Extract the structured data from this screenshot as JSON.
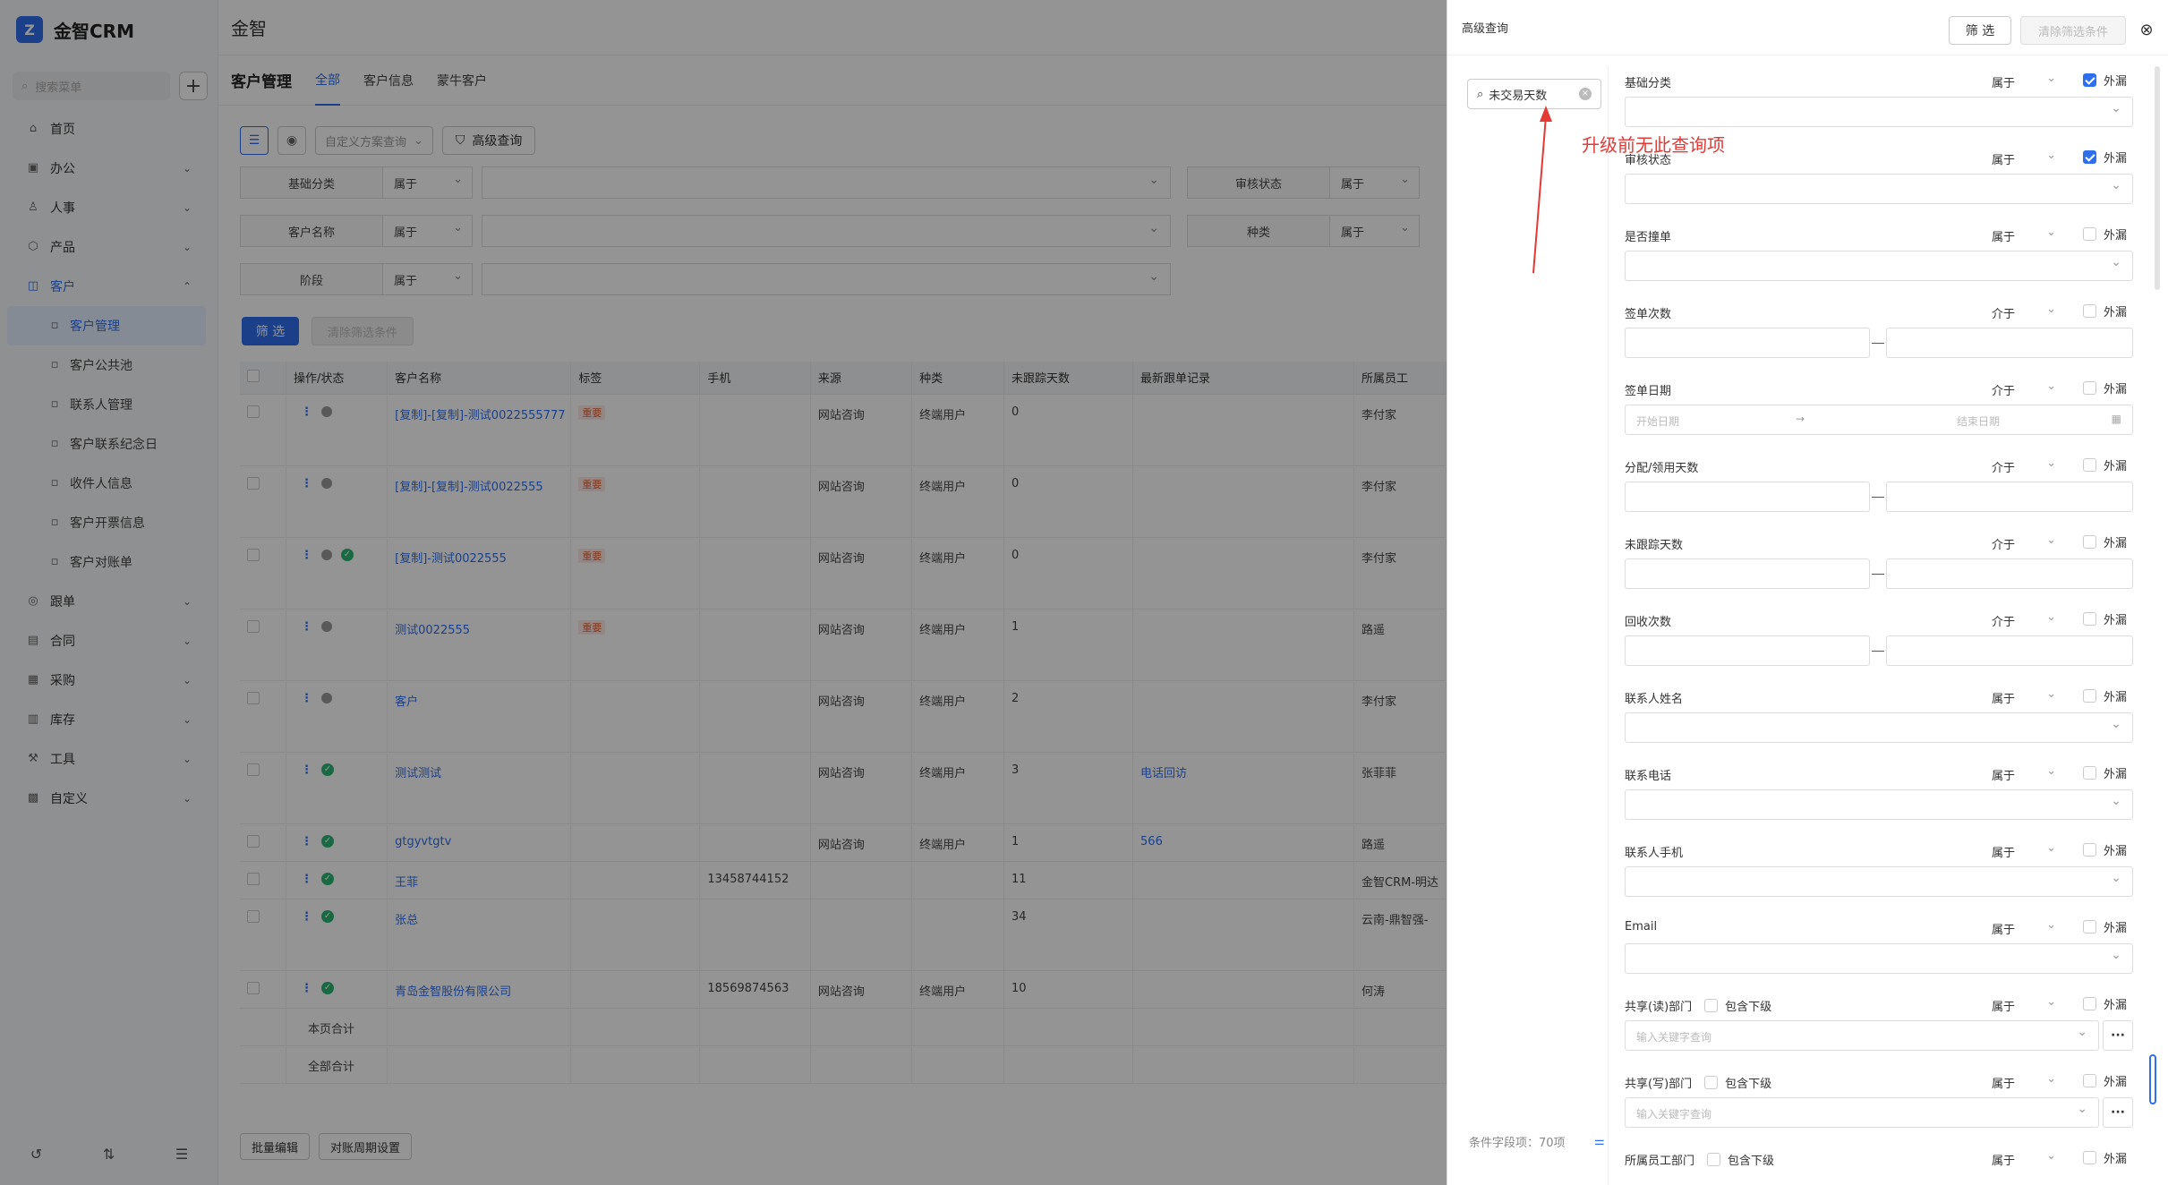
{
  "app": {
    "brand": "金智CRM",
    "page_title": "金智"
  },
  "sidebar": {
    "search_placeholder": "搜索菜单",
    "items": [
      {
        "label": "首页",
        "icon": "home-icon",
        "expandable": false
      },
      {
        "label": "办公",
        "icon": "office-icon",
        "expandable": true
      },
      {
        "label": "人事",
        "icon": "people-icon",
        "expandable": true
      },
      {
        "label": "产品",
        "icon": "product-icon",
        "expandable": true
      },
      {
        "label": "客户",
        "icon": "customer-icon",
        "expandable": true,
        "expanded": true
      },
      {
        "label": "跟单",
        "icon": "follow-icon",
        "expandable": true
      },
      {
        "label": "合同",
        "icon": "contract-icon",
        "expandable": true
      },
      {
        "label": "采购",
        "icon": "purchase-icon",
        "expandable": true
      },
      {
        "label": "库存",
        "icon": "inventory-icon",
        "expandable": true
      },
      {
        "label": "工具",
        "icon": "tool-icon",
        "expandable": true
      },
      {
        "label": "自定义",
        "icon": "custom-icon",
        "expandable": true
      }
    ],
    "customer_sub": [
      {
        "label": "客户管理",
        "active": true
      },
      {
        "label": "客户公共池"
      },
      {
        "label": "联系人管理"
      },
      {
        "label": "客户联系纪念日"
      },
      {
        "label": "收件人信息"
      },
      {
        "label": "客户开票信息"
      },
      {
        "label": "客户对账单"
      }
    ]
  },
  "main": {
    "section_title": "客户管理",
    "tabs": [
      "全部",
      "客户信息",
      "蒙牛客户"
    ],
    "scheme_placeholder": "自定义方案查询",
    "advanced_query_label": "高级查询",
    "filters": [
      {
        "label": "基础分类",
        "op": "属于",
        "label2": "审核状态",
        "op2": "属于"
      },
      {
        "label": "客户名称",
        "op": "属于",
        "label2": "种类",
        "op2": "属于"
      },
      {
        "label": "阶段",
        "op": "属于"
      }
    ],
    "filter_button": "筛 选",
    "clear_button": "清除筛选条件",
    "table": {
      "headers": [
        "操作/状态",
        "客户名称",
        "标签",
        "手机",
        "来源",
        "种类",
        "未跟踪天数",
        "最新跟单记录",
        "所属员工"
      ],
      "rows": [
        {
          "name": "[复制]-[复制]-测试0022555777",
          "tag": "重要",
          "phone": "",
          "source": "网站咨询",
          "kind": "终端用户",
          "days": "0",
          "record": "",
          "owner": "李付家",
          "status": "user"
        },
        {
          "name": "[复制]-[复制]-测试0022555",
          "tag": "重要",
          "phone": "",
          "source": "网站咨询",
          "kind": "终端用户",
          "days": "0",
          "record": "",
          "owner": "李付家",
          "status": "user"
        },
        {
          "name": "[复制]-测试0022555",
          "tag": "重要",
          "phone": "",
          "source": "网站咨询",
          "kind": "终端用户",
          "days": "0",
          "record": "",
          "owner": "李付家",
          "status": "user-ok"
        },
        {
          "name": "测试0022555",
          "tag": "重要",
          "phone": "",
          "source": "网站咨询",
          "kind": "终端用户",
          "days": "1",
          "record": "",
          "owner": "路遥",
          "status": "user"
        },
        {
          "name": "客户",
          "tag": "",
          "phone": "",
          "source": "网站咨询",
          "kind": "终端用户",
          "days": "2",
          "record": "",
          "owner": "李付家",
          "status": "user"
        },
        {
          "name": "测试测试",
          "tag": "",
          "phone": "",
          "source": "网站咨询",
          "kind": "终端用户",
          "days": "3",
          "record": "电话回访",
          "owner": "张菲菲",
          "status": "ok"
        },
        {
          "name": "gtgyvtgtv",
          "tag": "",
          "phone": "",
          "source": "网站咨询",
          "kind": "终端用户",
          "days": "1",
          "record": "566",
          "owner": "路遥",
          "status": "ok",
          "short": true
        },
        {
          "name": "王菲",
          "tag": "",
          "phone": "13458744152",
          "source": "",
          "kind": "",
          "days": "11",
          "record": "",
          "owner": "金智CRM-明达",
          "status": "ok",
          "short": true
        },
        {
          "name": "张总",
          "tag": "",
          "phone": "",
          "source": "",
          "kind": "",
          "days": "34",
          "record": "",
          "owner": "云南-鼎智强-",
          "status": "ok"
        },
        {
          "name": "青岛金智股份有限公司",
          "tag": "",
          "phone": "18569874563",
          "source": "网站咨询",
          "kind": "终端用户",
          "days": "10",
          "record": "",
          "owner": "何涛",
          "status": "ok",
          "short": true
        }
      ],
      "page_total_label": "本页合计",
      "all_total_label": "全部合计"
    },
    "bulk_edit_label": "批量编辑",
    "period_setting_label": "对账周期设置"
  },
  "drawer": {
    "title": "高级查询",
    "filter_button": "筛 选",
    "clear_button": "清除筛选条件",
    "search_value": "未交易天数",
    "annotation": "升级前无此查询项",
    "field_count": "条件字段项：70项",
    "leak_label": "外漏",
    "include_sub_label": "包含下级",
    "date_start_placeholder": "开始日期",
    "date_end_placeholder": "结束日期",
    "keyword_placeholder": "输入关键字查询",
    "fields": [
      {
        "label": "基础分类",
        "op": "属于",
        "leak": true,
        "type": "select"
      },
      {
        "label": "审核状态",
        "op": "属于",
        "leak": true,
        "type": "select"
      },
      {
        "label": "是否撞单",
        "op": "属于",
        "leak": false,
        "type": "select"
      },
      {
        "label": "签单次数",
        "op": "介于",
        "leak": false,
        "type": "range"
      },
      {
        "label": "签单日期",
        "op": "介于",
        "leak": false,
        "type": "date"
      },
      {
        "label": "分配/领用天数",
        "op": "介于",
        "leak": false,
        "type": "range"
      },
      {
        "label": "未跟踪天数",
        "op": "介于",
        "leak": false,
        "type": "range"
      },
      {
        "label": "回收次数",
        "op": "介于",
        "leak": false,
        "type": "range"
      },
      {
        "label": "联系人姓名",
        "op": "属于",
        "leak": false,
        "type": "select"
      },
      {
        "label": "联系电话",
        "op": "属于",
        "leak": false,
        "type": "select"
      },
      {
        "label": "联系人手机",
        "op": "属于",
        "leak": false,
        "type": "select"
      },
      {
        "label": "Email",
        "op": "属于",
        "leak": false,
        "type": "select"
      },
      {
        "label": "共享(读)部门",
        "op": "属于",
        "leak": false,
        "type": "keyword",
        "sub": true
      },
      {
        "label": "共享(写)部门",
        "op": "属于",
        "leak": false,
        "type": "keyword",
        "sub": true
      },
      {
        "label": "所属员工部门",
        "op": "属于",
        "leak": false,
        "type": "none",
        "sub": true
      }
    ]
  }
}
